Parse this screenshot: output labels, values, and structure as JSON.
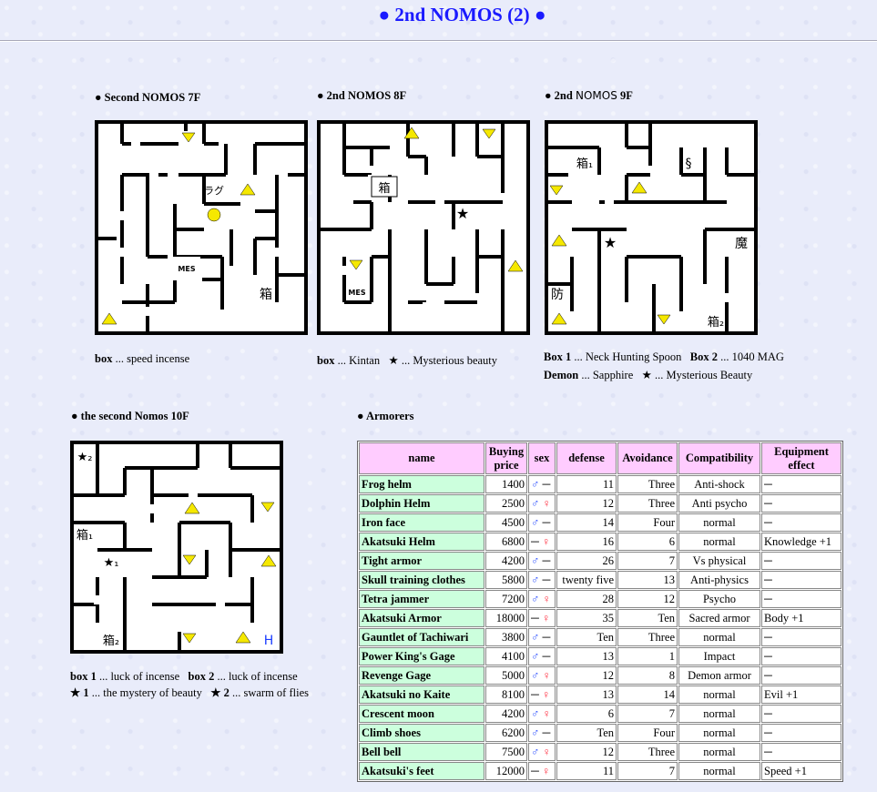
{
  "title": "● 2nd NOMOS (2) ●",
  "maps": {
    "f7": {
      "label": "● Second NOMOS 7F",
      "caption_key": "box",
      "caption_val": " ... speed incense",
      "marks": {
        "rag": "ラグ",
        "mes": "MES",
        "box": "箱"
      }
    },
    "f8": {
      "label": "● 2nd NOMOS 8F",
      "caption_key": "box",
      "caption_val": " ... Kintan",
      "caption_star": "★ ... Mysterious beauty",
      "marks": {
        "box": "箱",
        "mes": "MES"
      }
    },
    "f9": {
      "label_a": "● 2nd ",
      "label_b": "NOMOS",
      "label_c": " 9F",
      "caption1_k1": "Box 1",
      "caption1_v1": " ... Neck Hunting Spoon ",
      "caption1_k2": "Box 2",
      "caption1_v2": " ... 1040 MAG",
      "caption2_k": "Demon",
      "caption2_v": " ... Sapphire ",
      "caption2_star": "★ ... Mysterious Beauty",
      "marks": {
        "box1": "箱₁",
        "section": "§",
        "demon": "魔",
        "def": "防",
        "box2": "箱₂"
      }
    },
    "f10": {
      "label": "● the second Nomos 10F",
      "caption1_k1": "box 1",
      "caption1_v1": " ... luck of incense ",
      "caption1_k2": "box 2",
      "caption1_v2": " ... luck of incense",
      "caption2_a": "★ 1",
      "caption2_av": " ... the mystery of beauty ",
      "caption2_b": "★ 2",
      "caption2_bv": " ... swarm of flies",
      "marks": {
        "star2": "★₂",
        "box1": "箱₁",
        "star1": "★₁",
        "box2": "箱₂",
        "h": "H"
      }
    }
  },
  "armorers": {
    "label": "● Armorers",
    "headers": [
      "name",
      "Buying price",
      "sex",
      "defense",
      "Avoidance",
      "Compatibility",
      "Equipment effect"
    ],
    "rows": [
      {
        "name": "Frog helm",
        "price": "1400",
        "m": "♂",
        "f": "─",
        "def": "11",
        "avo": "Three",
        "compat": "Anti-shock",
        "effect": "─"
      },
      {
        "name": "Dolphin Helm",
        "price": "2500",
        "m": "♂",
        "f": "♀",
        "def": "12",
        "avo": "Three",
        "compat": "Anti psycho",
        "effect": "─"
      },
      {
        "name": "Iron face",
        "price": "4500",
        "m": "♂",
        "f": "─",
        "def": "14",
        "avo": "Four",
        "compat": "normal",
        "effect": "─"
      },
      {
        "name": "Akatsuki Helm",
        "price": "6800",
        "m": "─",
        "f": "♀",
        "def": "16",
        "avo": "6",
        "compat": "normal",
        "effect": "Knowledge +1"
      },
      {
        "name": "Tight armor",
        "price": "4200",
        "m": "♂",
        "f": "─",
        "def": "26",
        "avo": "7",
        "compat": "Vs physical",
        "effect": "─"
      },
      {
        "name": "Skull training clothes",
        "price": "5800",
        "m": "♂",
        "f": "─",
        "def": "twenty five",
        "avo": "13",
        "compat": "Anti-physics",
        "effect": "─"
      },
      {
        "name": "Tetra jammer",
        "price": "7200",
        "m": "♂",
        "f": "♀",
        "def": "28",
        "avo": "12",
        "compat": "Psycho",
        "effect": "─"
      },
      {
        "name": "Akatsuki Armor",
        "price": "18000",
        "m": "─",
        "f": "♀",
        "def": "35",
        "avo": "Ten",
        "compat": "Sacred armor",
        "effect": "Body +1"
      },
      {
        "name": "Gauntlet of Tachiwari",
        "price": "3800",
        "m": "♂",
        "f": "─",
        "def": "Ten",
        "avo": "Three",
        "compat": "normal",
        "effect": "─"
      },
      {
        "name": "Power King's Gage",
        "price": "4100",
        "m": "♂",
        "f": "─",
        "def": "13",
        "avo": "1",
        "compat": "Impact",
        "effect": "─"
      },
      {
        "name": "Revenge Gage",
        "price": "5000",
        "m": "♂",
        "f": "♀",
        "def": "12",
        "avo": "8",
        "compat": "Demon armor",
        "effect": "─"
      },
      {
        "name": "Akatsuki no Kaite",
        "price": "8100",
        "m": "─",
        "f": "♀",
        "def": "13",
        "avo": "14",
        "compat": "normal",
        "effect": "Evil +1"
      },
      {
        "name": "Crescent moon",
        "price": "4200",
        "m": "♂",
        "f": "♀",
        "def": "6",
        "avo": "7",
        "compat": "normal",
        "effect": "─"
      },
      {
        "name": "Climb shoes",
        "price": "6200",
        "m": "♂",
        "f": "─",
        "def": "Ten",
        "avo": "Four",
        "compat": "normal",
        "effect": "─"
      },
      {
        "name": "Bell bell",
        "price": "7500",
        "m": "♂",
        "f": "♀",
        "def": "12",
        "avo": "Three",
        "compat": "normal",
        "effect": "─"
      },
      {
        "name": "Akatsuki's feet",
        "price": "12000",
        "m": "─",
        "f": "♀",
        "def": "11",
        "avo": "7",
        "compat": "normal",
        "effect": "Speed +1"
      }
    ]
  }
}
